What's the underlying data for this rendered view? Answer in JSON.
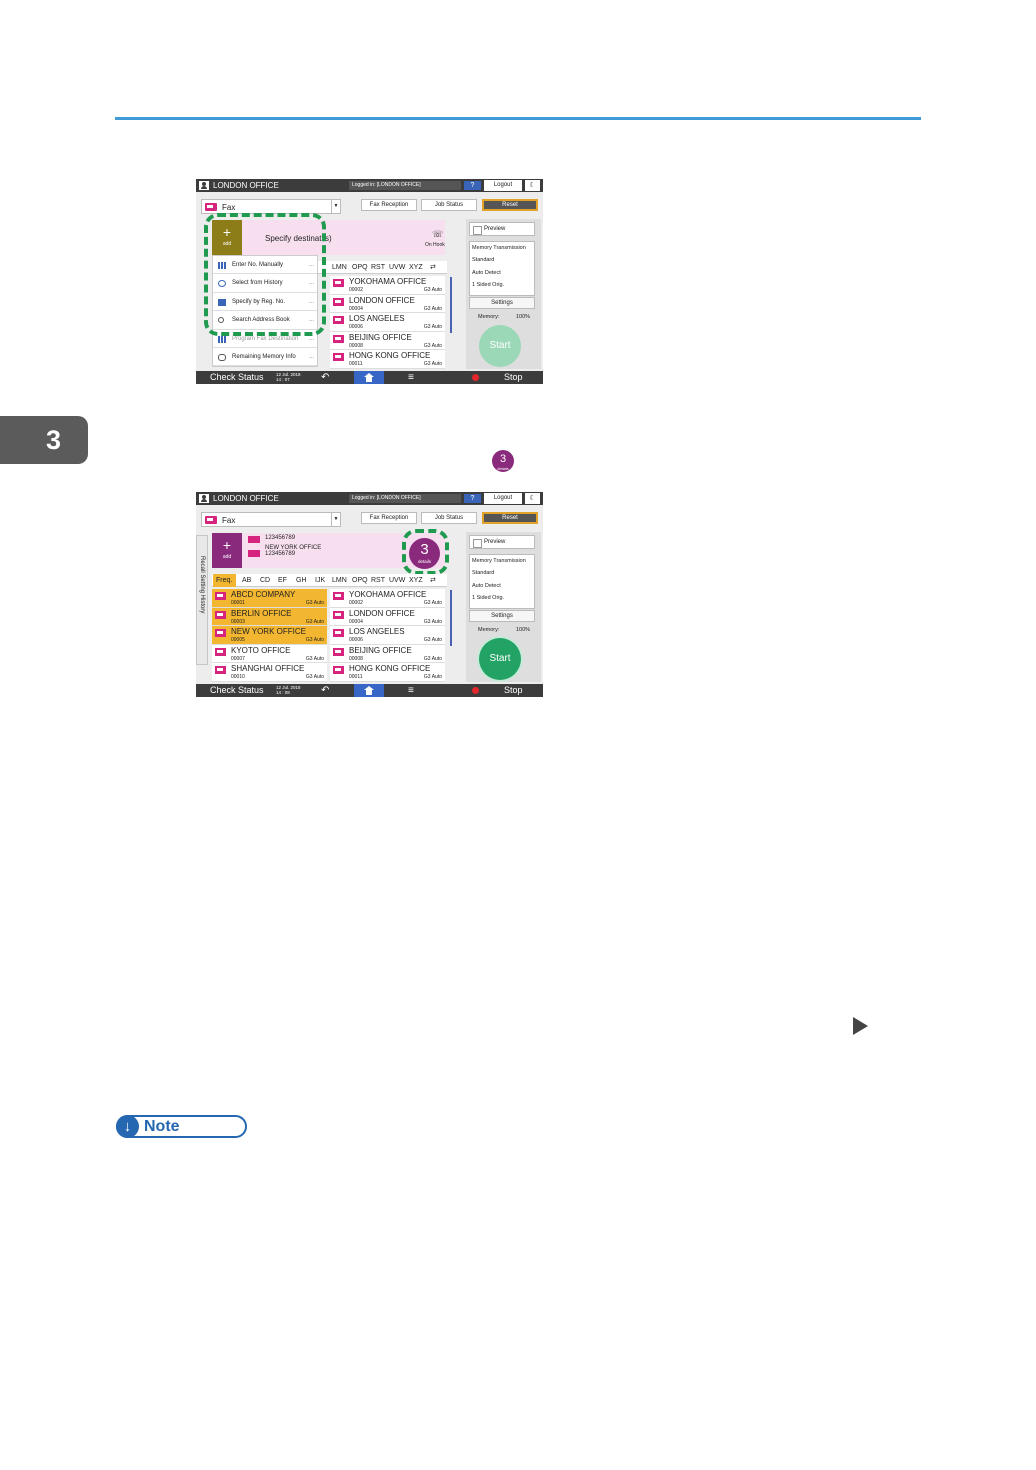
{
  "chapter": "3",
  "badge": {
    "number": "3",
    "sub": "details"
  },
  "note_label": "Note",
  "screen_common": {
    "user": "LONDON OFFICE",
    "logged_in": "Logged in: [LONDON OFFICE]",
    "help": "?",
    "logout": "Logout",
    "fax_label": "Fax",
    "fax_reception": "Fax Reception",
    "job_status": "Job Status",
    "reset": "Reset",
    "plus": "+",
    "add_label": "add",
    "tabs": [
      "Freq.",
      "AB",
      "CD",
      "EF",
      "GH",
      "IJK",
      "LMN",
      "OPQ",
      "RST",
      "UVW",
      "XYZ"
    ],
    "preview": "Preview",
    "settings_lines": [
      "Memory Transmission",
      "Standard",
      "Auto Detect",
      "1 Sided Orig."
    ],
    "settings_button": "Settings",
    "memory_label": "Memory:",
    "memory_value": "100%",
    "start": "Start",
    "check_status": "Check Status",
    "stop": "Stop",
    "right_entries": [
      {
        "name": "YOKOHAMA OFFICE",
        "num": "00002",
        "mode": "G3 Auto"
      },
      {
        "name": "LONDON OFFICE",
        "num": "00004",
        "mode": "G3 Auto"
      },
      {
        "name": "LOS ANGELES",
        "num": "00006",
        "mode": "G3 Auto"
      },
      {
        "name": "BEIJING OFFICE",
        "num": "00008",
        "mode": "G3 Auto"
      },
      {
        "name": "HONG KONG OFFICE",
        "num": "00011",
        "mode": "G3 Auto"
      }
    ]
  },
  "shot1": {
    "date": "12 Jul. 2018",
    "time": "14 : 07",
    "specify_text": "Specify destinat",
    "specify_tail": "s)",
    "on_hook": "On Hook",
    "menu_items": [
      {
        "label": "Enter No. Manually",
        "icon": "keypad-icon"
      },
      {
        "label": "Select from History",
        "icon": "clock-icon"
      },
      {
        "label": "Specify by Reg. No.",
        "icon": "reg-number-icon"
      },
      {
        "label": "Search Address Book",
        "icon": "search-icon"
      },
      {
        "label": "Program Fax Destination",
        "icon": "program-icon"
      },
      {
        "label": "Remaining Memory Info",
        "icon": "database-icon"
      }
    ],
    "more": "..."
  },
  "shot2": {
    "date": "12 Jul. 2018",
    "time": "14 : 08",
    "recall": "Recall Setting History",
    "dest_numbers": [
      {
        "name": "",
        "num": "123456789"
      },
      {
        "name": "NEW YORK OFFICE",
        "num": "123456789"
      }
    ],
    "count": "3",
    "count_sub": "details",
    "left_entries": [
      {
        "name": "ABCD COMPANY",
        "num": "00001",
        "mode": "G3 Auto"
      },
      {
        "name": "BERLIN OFFICE",
        "num": "00003",
        "mode": "G3 Auto"
      },
      {
        "name": "NEW YORK OFFICE",
        "num": "00005",
        "mode": "G3 Auto"
      },
      {
        "name": "KYOTO OFFICE",
        "num": "00007",
        "mode": "G3 Auto"
      },
      {
        "name": "SHANGHAI OFFICE",
        "num": "00010",
        "mode": "G3 Auto"
      }
    ]
  }
}
